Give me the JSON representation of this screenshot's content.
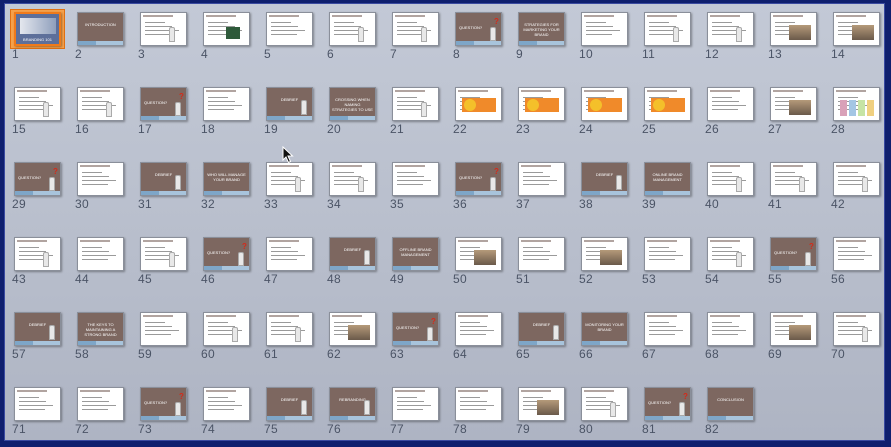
{
  "slides": [
    {
      "n": "1",
      "style": "photo",
      "text": "BRANDING 101"
    },
    {
      "n": "2",
      "style": "brown",
      "text": "INTRODUCTION"
    },
    {
      "n": "3",
      "style": "white-figure",
      "text": ""
    },
    {
      "n": "4",
      "style": "white-board",
      "text": ""
    },
    {
      "n": "5",
      "style": "white-text",
      "text": ""
    },
    {
      "n": "6",
      "style": "white-figure",
      "text": ""
    },
    {
      "n": "7",
      "style": "white-figure",
      "text": ""
    },
    {
      "n": "8",
      "style": "brown-question",
      "text": "QUESTION?"
    },
    {
      "n": "9",
      "style": "brown",
      "text": "STRATEGIES FOR MARKETING YOUR BRAND"
    },
    {
      "n": "10",
      "style": "white-text",
      "text": ""
    },
    {
      "n": "11",
      "style": "white-figure",
      "text": ""
    },
    {
      "n": "12",
      "style": "white-figure",
      "text": ""
    },
    {
      "n": "13",
      "style": "white-photo",
      "text": ""
    },
    {
      "n": "14",
      "style": "white-photo",
      "text": ""
    },
    {
      "n": "15",
      "style": "white-figure",
      "text": ""
    },
    {
      "n": "16",
      "style": "white-figure",
      "text": ""
    },
    {
      "n": "17",
      "style": "brown-question",
      "text": "QUESTION?"
    },
    {
      "n": "18",
      "style": "white-text",
      "text": ""
    },
    {
      "n": "19",
      "style": "brown",
      "text": "DEBRIEF"
    },
    {
      "n": "20",
      "style": "brown",
      "text": "CROSSING WHEN NAMING STRATEGIES TO USE"
    },
    {
      "n": "21",
      "style": "white-figure",
      "text": ""
    },
    {
      "n": "22",
      "style": "white-orange",
      "text": ""
    },
    {
      "n": "23",
      "style": "white-orange",
      "text": ""
    },
    {
      "n": "24",
      "style": "white-orange",
      "text": ""
    },
    {
      "n": "25",
      "style": "white-orange",
      "text": ""
    },
    {
      "n": "26",
      "style": "white-text",
      "text": ""
    },
    {
      "n": "27",
      "style": "white-photo",
      "text": ""
    },
    {
      "n": "28",
      "style": "white-colors",
      "text": ""
    },
    {
      "n": "29",
      "style": "brown-question",
      "text": "QUESTION?"
    },
    {
      "n": "30",
      "style": "white-text",
      "text": ""
    },
    {
      "n": "31",
      "style": "brown",
      "text": "DEBRIEF"
    },
    {
      "n": "32",
      "style": "brown",
      "text": "WHO WILL MANAGE YOUR BRAND"
    },
    {
      "n": "33",
      "style": "white-figure",
      "text": ""
    },
    {
      "n": "34",
      "style": "white-figure",
      "text": ""
    },
    {
      "n": "35",
      "style": "white-text",
      "text": ""
    },
    {
      "n": "36",
      "style": "brown-question",
      "text": "QUESTION?"
    },
    {
      "n": "37",
      "style": "white-text",
      "text": ""
    },
    {
      "n": "38",
      "style": "brown",
      "text": "DEBRIEF"
    },
    {
      "n": "39",
      "style": "brown",
      "text": "ONLINE BRAND MANAGEMENT"
    },
    {
      "n": "40",
      "style": "white-figure",
      "text": ""
    },
    {
      "n": "41",
      "style": "white-figure",
      "text": ""
    },
    {
      "n": "42",
      "style": "white-figure",
      "text": ""
    },
    {
      "n": "43",
      "style": "white-figure",
      "text": ""
    },
    {
      "n": "44",
      "style": "white-text",
      "text": ""
    },
    {
      "n": "45",
      "style": "white-figure",
      "text": ""
    },
    {
      "n": "46",
      "style": "brown-question",
      "text": "QUESTION?"
    },
    {
      "n": "47",
      "style": "white-text",
      "text": ""
    },
    {
      "n": "48",
      "style": "brown",
      "text": "DEBRIEF"
    },
    {
      "n": "49",
      "style": "brown",
      "text": "OFFLINE BRAND MANAGEMENT"
    },
    {
      "n": "50",
      "style": "white-photo",
      "text": ""
    },
    {
      "n": "51",
      "style": "white-text",
      "text": ""
    },
    {
      "n": "52",
      "style": "white-photo",
      "text": ""
    },
    {
      "n": "53",
      "style": "white-text",
      "text": ""
    },
    {
      "n": "54",
      "style": "white-figure",
      "text": ""
    },
    {
      "n": "55",
      "style": "brown-question",
      "text": "QUESTION?"
    },
    {
      "n": "56",
      "style": "white-text",
      "text": ""
    },
    {
      "n": "57",
      "style": "brown",
      "text": "DEBRIEF"
    },
    {
      "n": "58",
      "style": "brown",
      "text": "THE KEYS TO MAINTAINING A STRONG BRAND"
    },
    {
      "n": "59",
      "style": "white-text",
      "text": ""
    },
    {
      "n": "60",
      "style": "white-figure",
      "text": ""
    },
    {
      "n": "61",
      "style": "white-figure",
      "text": ""
    },
    {
      "n": "62",
      "style": "white-photo",
      "text": ""
    },
    {
      "n": "63",
      "style": "brown-question",
      "text": "QUESTION?"
    },
    {
      "n": "64",
      "style": "white-text",
      "text": ""
    },
    {
      "n": "65",
      "style": "brown",
      "text": "DEBRIEF"
    },
    {
      "n": "66",
      "style": "brown",
      "text": "MONITORING YOUR BRAND"
    },
    {
      "n": "67",
      "style": "white-text",
      "text": ""
    },
    {
      "n": "68",
      "style": "white-text",
      "text": ""
    },
    {
      "n": "69",
      "style": "white-photo",
      "text": ""
    },
    {
      "n": "70",
      "style": "white-figure",
      "text": ""
    },
    {
      "n": "71",
      "style": "white-text",
      "text": ""
    },
    {
      "n": "72",
      "style": "white-text",
      "text": ""
    },
    {
      "n": "73",
      "style": "brown-question",
      "text": "QUESTION?"
    },
    {
      "n": "74",
      "style": "white-text",
      "text": ""
    },
    {
      "n": "75",
      "style": "brown",
      "text": "DEBRIEF"
    },
    {
      "n": "76",
      "style": "brown",
      "text": "REBRANDING"
    },
    {
      "n": "77",
      "style": "white-text",
      "text": ""
    },
    {
      "n": "78",
      "style": "white-text",
      "text": ""
    },
    {
      "n": "79",
      "style": "white-photo",
      "text": ""
    },
    {
      "n": "80",
      "style": "white-figure",
      "text": ""
    },
    {
      "n": "81",
      "style": "brown-question",
      "text": "QUESTION?"
    },
    {
      "n": "82",
      "style": "brown",
      "text": "CONCLUSION"
    }
  ],
  "selected_slide": "1",
  "colors": {
    "brown": "#7d6760",
    "accent_blue": "#7ea6c8",
    "selection": "#f07a1a",
    "background": "#b9bfcc",
    "frame": "#0f1f6e"
  }
}
